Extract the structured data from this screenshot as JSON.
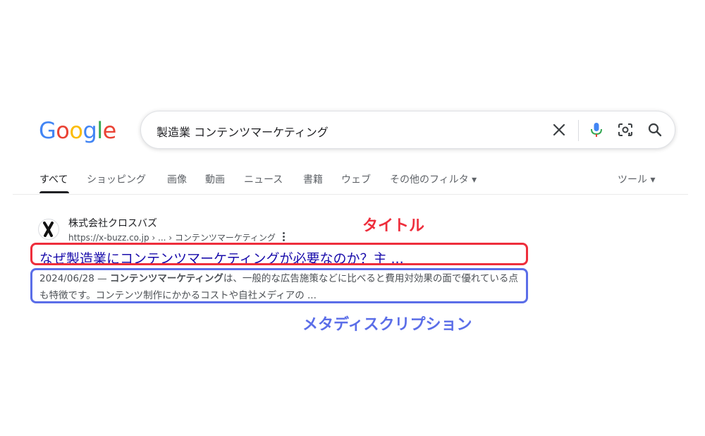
{
  "logo": {
    "letters": [
      "G",
      "o",
      "o",
      "g",
      "l",
      "e"
    ],
    "colors": [
      "#4285f4",
      "#ea4335",
      "#fbbc05",
      "#4285f4",
      "#34a853",
      "#ea4335"
    ]
  },
  "search": {
    "query": "製造業 コンテンツマーケティング"
  },
  "icons": {
    "clear": "close-icon",
    "voice": "microphone-icon",
    "lens": "camera-lens-icon",
    "search": "search-icon"
  },
  "tabs": [
    {
      "label": "すべて",
      "active": true
    },
    {
      "label": "ショッピング"
    },
    {
      "label": "画像"
    },
    {
      "label": "動画"
    },
    {
      "label": "ニュース"
    },
    {
      "label": "書籍"
    },
    {
      "label": "ウェブ"
    },
    {
      "label": "その他のフィルタ ▾"
    }
  ],
  "tools": "ツール ▾",
  "result": {
    "site_name": "株式会社クロスバズ",
    "url": "https://x-buzz.co.jp › ... › コンテンツマーケティング",
    "title": "なぜ製造業にコンテンツマーケティングが必要なのか？主 ...",
    "date": "2024/06/28",
    "date_sep": " — ",
    "snippet_bold": "コンテンツマーケティング",
    "snippet_rest": "は、一般的な広告施策などに比べると費用対効果の面で優れている点も特徴です。コンテンツ制作にかかるコストや自社メディアの ..."
  },
  "annotations": {
    "title_label": "タイトル",
    "description_label": "メタディスクリプション",
    "title_color": "#ee2e3c",
    "description_color": "#5b6ee8"
  }
}
